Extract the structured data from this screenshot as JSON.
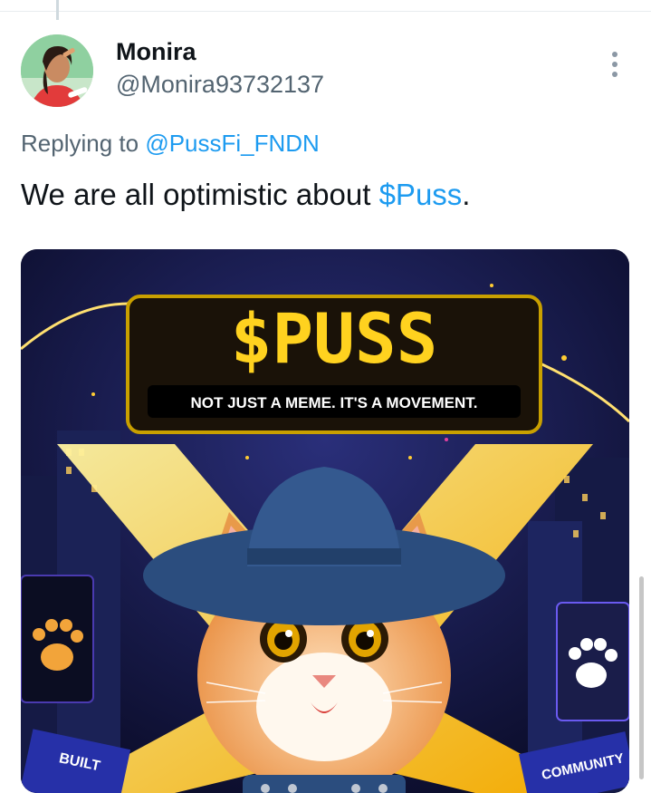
{
  "tweet": {
    "display_name": "Monira",
    "handle": "@Monira93732137",
    "replying_prefix": "Replying to ",
    "replying_to": "@PussFi_FNDN",
    "text_before": "We are all optimistic about ",
    "text_cashtag": "$Puss",
    "text_after": "."
  },
  "media": {
    "sign_title": "$PUSS",
    "sign_subtitle": "NOT JUST A MEME. IT'S A MOVEMENT.",
    "banner_left": "BUILT",
    "banner_right": "COMMUNITY"
  },
  "colors": {
    "link": "#1d9bf0",
    "text": "#0f1419",
    "muted": "#536471",
    "neon_yellow": "#ffd21f"
  },
  "icons": {
    "more": "more-vertical-icon"
  }
}
